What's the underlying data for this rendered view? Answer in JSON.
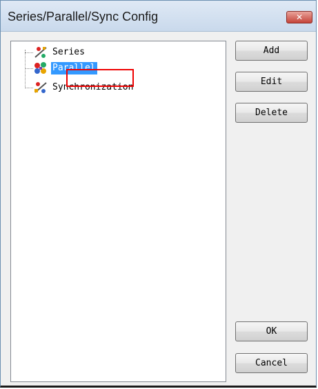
{
  "window": {
    "title": "Series/Parallel/Sync Config",
    "close_glyph": "✕"
  },
  "tree": {
    "items": [
      {
        "label": "Series",
        "icon": "series-icon"
      },
      {
        "label": "Parallel",
        "icon": "parallel-icon",
        "selected": true
      },
      {
        "label": "Synchronization",
        "icon": "synchronization-icon"
      }
    ]
  },
  "buttons": {
    "add": "Add",
    "edit": "Edit",
    "delete": "Delete",
    "ok": "OK",
    "cancel": "Cancel"
  },
  "colors": {
    "selection": "#3399ff",
    "highlight": "#ee0000",
    "close": "#c5443a"
  }
}
